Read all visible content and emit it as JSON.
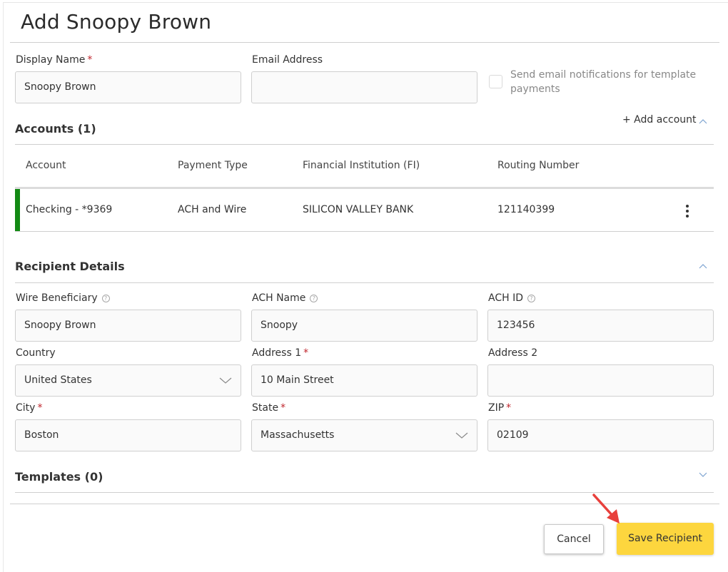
{
  "page": {
    "title": "Add Snoopy Brown"
  },
  "top_form": {
    "display_name": {
      "label": "Display Name",
      "required_mark": "*",
      "value": "Snoopy Brown"
    },
    "email": {
      "label": "Email Address",
      "value": ""
    },
    "notify_checkbox": {
      "label": "Send email notifications for template payments",
      "checked": false
    }
  },
  "accounts": {
    "title": "Accounts (1)",
    "add_account_label": "+ Add account",
    "collapse_icon": "chevron-up-icon",
    "columns": [
      "Account",
      "Payment Type",
      "Financial Institution (FI)",
      "Routing Number"
    ],
    "rows": [
      {
        "account": "Checking - *9369",
        "payment_type": "ACH and Wire",
        "fi": "SILICON VALLEY BANK",
        "routing": "121140399",
        "accent_color": "#138a14",
        "menu_icon": "kebab-menu-icon"
      }
    ]
  },
  "recipient_details": {
    "title": "Recipient Details",
    "collapse_icon": "chevron-up-icon",
    "fields": {
      "wire_beneficiary": {
        "label": "Wire Beneficiary",
        "value": "Snoopy Brown",
        "help_icon": "help-circle-icon"
      },
      "ach_name": {
        "label": "ACH Name",
        "value": "Snoopy",
        "help_icon": "help-circle-icon"
      },
      "ach_id": {
        "label": "ACH ID",
        "value": "123456",
        "help_icon": "help-circle-icon"
      },
      "country": {
        "label": "Country",
        "value": "United States"
      },
      "address1": {
        "label": "Address 1",
        "required_mark": "*",
        "value": "10 Main Street"
      },
      "address2": {
        "label": "Address 2",
        "value": ""
      },
      "city": {
        "label": "City",
        "required_mark": "*",
        "value": "Boston"
      },
      "state": {
        "label": "State",
        "required_mark": "*",
        "value": "Massachusetts"
      },
      "zip": {
        "label": "ZIP",
        "required_mark": "*",
        "value": "02109"
      }
    }
  },
  "templates": {
    "title": "Templates (0)",
    "expand_icon": "chevron-down-icon"
  },
  "footer": {
    "cancel_label": "Cancel",
    "save_label": "Save Recipient",
    "save_color": "#fdd63e",
    "annotation_arrow_color": "#e8403c"
  }
}
